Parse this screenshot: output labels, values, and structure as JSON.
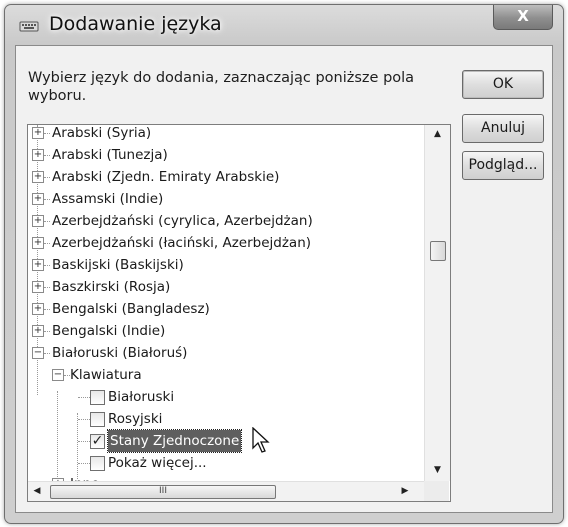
{
  "window": {
    "title": "Dodawanie języka",
    "close_label": "X"
  },
  "instruction": "Wybierz język do dodania, zaznaczając poniższe pola wyboru.",
  "buttons": {
    "ok": "OK",
    "cancel": "Anuluj",
    "preview": "Podgląd..."
  },
  "tree": {
    "languages": [
      "Arabski (Syria)",
      "Arabski (Tunezja)",
      "Arabski (Zjedn. Emiraty Arabskie)",
      "Assamski (Indie)",
      "Azerbejdżański (cyrylica, Azerbejdżan)",
      "Azerbejdżański (łaciński, Azerbejdżan)",
      "Baskijski (Baskijski)",
      "Baszkirski (Rosja)",
      "Bengalski (Bangladesz)",
      "Bengalski (Indie)",
      "Białoruski (Białoruś)"
    ],
    "keyboard_group": "Klawiatura",
    "keyboards": [
      {
        "label": "Białoruski",
        "checked": false
      },
      {
        "label": "Rosyjski",
        "checked": false
      },
      {
        "label": "Stany Zjednoczone",
        "checked": true
      },
      {
        "label": "Pokaż więcej...",
        "checked": false
      }
    ],
    "other_group": "Inne"
  },
  "scrollbar": {
    "horizontal_thumb_grip": "III"
  }
}
